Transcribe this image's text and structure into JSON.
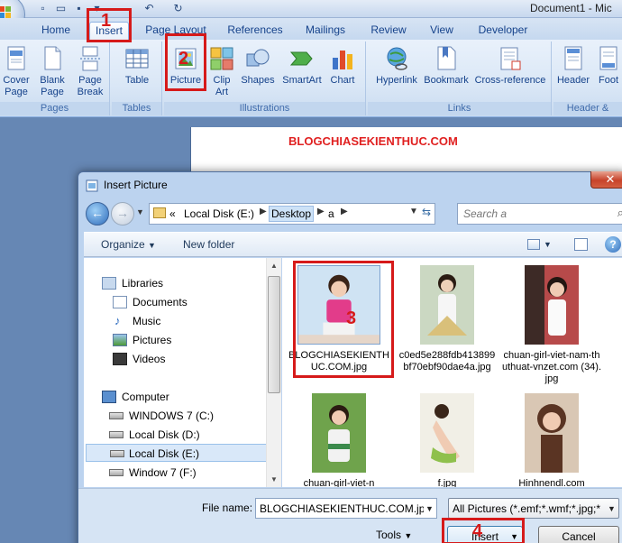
{
  "window": {
    "title": "Document1 - Mic",
    "quick_access": [
      "save-icon",
      "undo-icon",
      "redo-icon"
    ]
  },
  "tabs": [
    {
      "label": "Home"
    },
    {
      "label": "Insert"
    },
    {
      "label": "Page Layout"
    },
    {
      "label": "References"
    },
    {
      "label": "Mailings"
    },
    {
      "label": "Review"
    },
    {
      "label": "View"
    },
    {
      "label": "Developer"
    }
  ],
  "ribbon": {
    "groups": [
      {
        "label": "Pages",
        "buttons": [
          "Cover Page",
          "Blank Page",
          "Page Break"
        ]
      },
      {
        "label": "Tables",
        "buttons": [
          "Table"
        ]
      },
      {
        "label": "Illustrations",
        "buttons": [
          "Picture",
          "Clip Art",
          "Shapes",
          "SmartArt",
          "Chart"
        ]
      },
      {
        "label": "Links",
        "buttons": [
          "Hyperlink",
          "Bookmark",
          "Cross-reference"
        ]
      },
      {
        "label": "Header &",
        "buttons": [
          "Header",
          "Foot"
        ]
      }
    ],
    "cover_l1": "Cover",
    "cover_l2": "Page",
    "blank_l1": "Blank",
    "blank_l2": "Page",
    "break_l1": "Page",
    "break_l2": "Break",
    "table": "Table",
    "picture": "Picture",
    "clip_l1": "Clip",
    "clip_l2": "Art",
    "shapes": "Shapes",
    "smartart": "SmartArt",
    "chart": "Chart",
    "hyperlink": "Hyperlink",
    "bookmark": "Bookmark",
    "crossref": "Cross-reference",
    "header": "Header",
    "footer": "Foot"
  },
  "document": {
    "text": "BLOGCHIASEKIENTHUC.COM"
  },
  "dialog": {
    "title": "Insert Picture",
    "breadcrumb": {
      "prefix": "«",
      "items": [
        "Local Disk (E:)",
        "Desktop",
        "a"
      ]
    },
    "search_placeholder": "Search a",
    "commands": {
      "organize": "Organize",
      "new_folder": "New folder"
    },
    "nav": {
      "libraries": "Libraries",
      "documents": "Documents",
      "music": "Music",
      "pictures": "Pictures",
      "videos": "Videos",
      "computer": "Computer",
      "drive_c": "WINDOWS 7 (C:)",
      "drive_d": "Local Disk (D:)",
      "drive_e": "Local Disk (E:)",
      "drive_f": "Window 7 (F:)"
    },
    "files": [
      {
        "name": "BLOGCHIASEKIENTHUC.COM.jpg",
        "selected": true
      },
      {
        "name": "c0ed5e288fdb413899bf70ebf90dae4a.jpg",
        "selected": false
      },
      {
        "name": "chuan-girl-viet-nam-thuthuat-vnzet.com (34).jpg",
        "selected": false
      },
      {
        "name": "chuan-girl-viet-n",
        "selected": false
      },
      {
        "name": "f.jpg",
        "selected": false
      },
      {
        "name": "Hinhnendl.com",
        "selected": false
      }
    ],
    "file_name_label": "File name:",
    "file_name_value": "BLOGCHIASEKIENTHUC.COM.jpg",
    "filter": "All Pictures (*.emf;*.wmf;*.jpg;*",
    "tools": "Tools",
    "insert": "Insert",
    "cancel": "Cancel"
  },
  "annotations": [
    "1",
    "2",
    "3",
    "4"
  ],
  "colors": {
    "annotation": "#d61a1a",
    "document_text": "#e02020",
    "ribbon_text": "#15428b"
  }
}
